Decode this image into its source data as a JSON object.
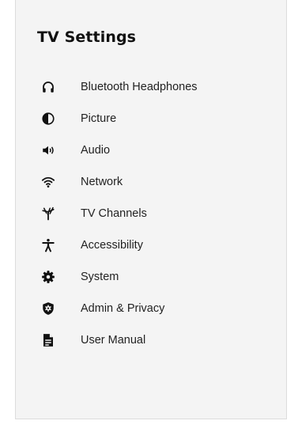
{
  "page": {
    "title": "TV Settings"
  },
  "colors": {
    "panel_background": "#f4f4f4",
    "text": "#222222",
    "icon": "#111111"
  },
  "menu": {
    "items": [
      {
        "label": "Bluetooth Headphones",
        "icon": "headphones-icon"
      },
      {
        "label": "Picture",
        "icon": "picture-contrast-icon"
      },
      {
        "label": "Audio",
        "icon": "speaker-icon"
      },
      {
        "label": "Network",
        "icon": "wifi-icon"
      },
      {
        "label": "TV Channels",
        "icon": "antenna-icon"
      },
      {
        "label": "Accessibility",
        "icon": "accessibility-icon"
      },
      {
        "label": "System",
        "icon": "gear-icon"
      },
      {
        "label": "Admin & Privacy",
        "icon": "shield-gear-icon"
      },
      {
        "label": "User Manual",
        "icon": "document-icon"
      }
    ]
  }
}
